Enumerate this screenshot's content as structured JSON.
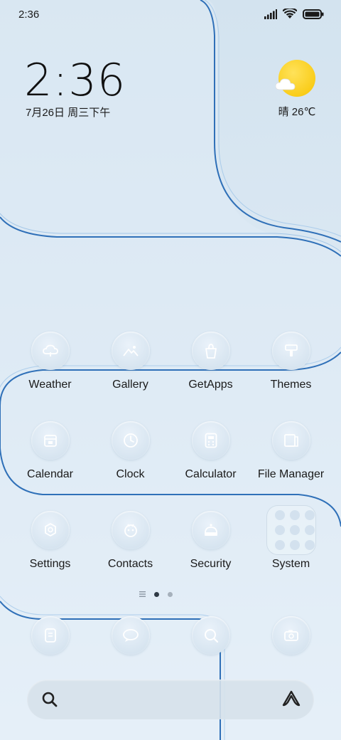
{
  "status_bar": {
    "time": "2:36",
    "icons": [
      "signal-icon",
      "wifi-icon",
      "battery-icon"
    ]
  },
  "clock_widget": {
    "time": "2:36",
    "date": "7月26日 周三下午"
  },
  "weather_widget": {
    "condition_icon": "sun-cloud-icon",
    "text": "晴 26℃",
    "sun_color": "#f7c400"
  },
  "apps": {
    "row1": [
      {
        "label": "Weather",
        "icon": "cloud-icon"
      },
      {
        "label": "Gallery",
        "icon": "mountain-icon"
      },
      {
        "label": "GetApps",
        "icon": "shopping-bag-icon"
      },
      {
        "label": "Themes",
        "icon": "brush-icon"
      }
    ],
    "row2": [
      {
        "label": "Calendar",
        "icon": "calendar-icon"
      },
      {
        "label": "Clock",
        "icon": "clock-icon"
      },
      {
        "label": "Calculator",
        "icon": "calculator-icon"
      },
      {
        "label": "File Manager",
        "icon": "folder-icon"
      }
    ],
    "row3": [
      {
        "label": "Settings",
        "icon": "gear-icon"
      },
      {
        "label": "Contacts",
        "icon": "contacts-icon"
      },
      {
        "label": "Security",
        "icon": "shield-icon"
      },
      {
        "label": "System",
        "icon": "folder-grid-icon"
      }
    ]
  },
  "page_indicator": {
    "pages": 2,
    "current": 1
  },
  "dock": [
    {
      "icon": "phone-icon"
    },
    {
      "icon": "message-icon"
    },
    {
      "icon": "browser-icon"
    },
    {
      "icon": "camera-icon"
    }
  ],
  "search_bar": {
    "left_icon": "search-icon",
    "right_icon": "assistant-icon"
  },
  "colors": {
    "background": "#dbe8f3",
    "icon_bg": "#d7e5f0",
    "icon_glyph": "#ffffff",
    "wave_line": "#2f70b8"
  }
}
